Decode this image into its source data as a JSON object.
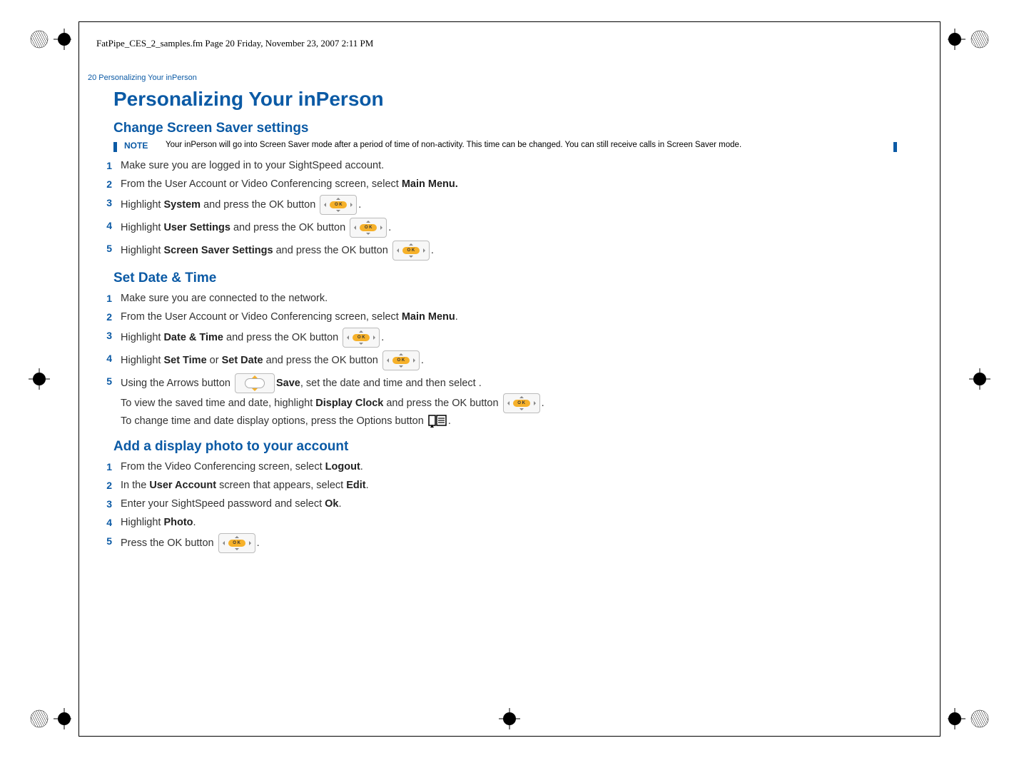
{
  "runner": "FatPipe_CES_2_samples.fm  Page 20  Friday, November 23, 2007  2:11 PM",
  "pageHeader": "20  Personalizing Your inPerson",
  "title": "Personalizing Your inPerson",
  "sections": {
    "screensaver": {
      "heading": "Change Screen Saver settings",
      "noteLabel": "NOTE",
      "noteText": "Your inPerson will go into Screen Saver mode after a period of time of non-activity. This time can be changed. You can still receive calls in Screen Saver mode.",
      "steps": [
        {
          "n": "1",
          "pre": "Make sure you are logged in to your SightSpeed account."
        },
        {
          "n": "2",
          "pre": "From the User Account or Video Conferencing screen, select ",
          "b1": "Main Menu.",
          "post": ""
        },
        {
          "n": "3",
          "pre": "Highlight ",
          "b1": "System",
          "mid": " and press the OK button ",
          "ok": true,
          "post": "."
        },
        {
          "n": "4",
          "pre": "Highlight ",
          "b1": "User Settings",
          "mid": " and press the OK button ",
          "ok": true,
          "post": "."
        },
        {
          "n": "5",
          "pre": "Highlight ",
          "b1": "Screen Saver Settings",
          "mid": " and press the OK button ",
          "ok": true,
          "post": "."
        }
      ]
    },
    "datetime": {
      "heading": "Set Date & Time",
      "steps": [
        {
          "n": "1",
          "pre": "Make sure you are connected to the network."
        },
        {
          "n": "2",
          "pre": "From the User Account or Video Conferencing screen, select ",
          "b1": "Main Menu",
          "post": "."
        },
        {
          "n": "3",
          "pre": "Highlight ",
          "b1": "Date & Time",
          "mid": " and press the OK button ",
          "ok": true,
          "post": "."
        },
        {
          "n": "4",
          "pre": "Highlight ",
          "b1": "Set Time",
          "mid": " or ",
          "b2": "Set Date",
          "mid2": " and press the OK button ",
          "ok": true,
          "post": "."
        },
        {
          "n": "5",
          "pre": "Using the Arrows button ",
          "arrow": true,
          "mid": ", set the date and time and then select ",
          "b1": "Save",
          "post": ".",
          "line2pre": "To view the saved time and date, highlight ",
          "line2b": "Display Clock",
          "line2mid": " and press the OK button ",
          "line2ok": true,
          "line2post": ".",
          "line3pre": "To change time and date display options, press the Options button ",
          "line3opt": true,
          "line3post": "."
        }
      ]
    },
    "photo": {
      "heading": "Add a display photo to your account",
      "steps": [
        {
          "n": "1",
          "pre": "From the Video Conferencing screen, select ",
          "b1": "Logout",
          "post": "."
        },
        {
          "n": "2",
          "pre": "In the ",
          "b1": "User Account",
          "mid": " screen that appears, select ",
          "b2": "Edit",
          "post": "."
        },
        {
          "n": "3",
          "pre": "Enter your SightSpeed password and select ",
          "b1": "Ok",
          "post": "."
        },
        {
          "n": "4",
          "pre": "Highlight ",
          "b1": "Photo",
          "post": "."
        },
        {
          "n": "5",
          "pre": "Press the OK button ",
          "ok": true,
          "post": "."
        }
      ]
    }
  }
}
